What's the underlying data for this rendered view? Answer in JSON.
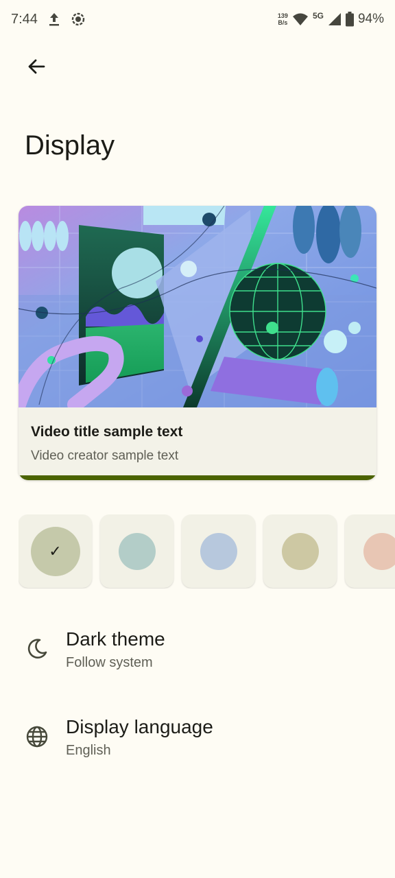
{
  "status_bar": {
    "time": "7:44",
    "net_speed_value": "139",
    "net_speed_unit": "B/s",
    "network_label": "5G",
    "battery": "94%"
  },
  "page": {
    "title": "Display"
  },
  "preview": {
    "video_title": "Video title sample text",
    "video_creator": "Video creator sample text",
    "progress": 1.0
  },
  "swatches": [
    {
      "color": "#c5c9aa",
      "selected": true
    },
    {
      "color": "#b3cdc8",
      "selected": false
    },
    {
      "color": "#b7c8dd",
      "selected": false
    },
    {
      "color": "#cdc8a3",
      "selected": false
    },
    {
      "color": "#e8c6b4",
      "selected": false
    }
  ],
  "settings": {
    "dark_theme": {
      "title": "Dark theme",
      "subtitle": "Follow system"
    },
    "display_language": {
      "title": "Display language",
      "subtitle": "English"
    }
  },
  "colors": {
    "accent": "#4b6300",
    "icon": "#46483a"
  }
}
